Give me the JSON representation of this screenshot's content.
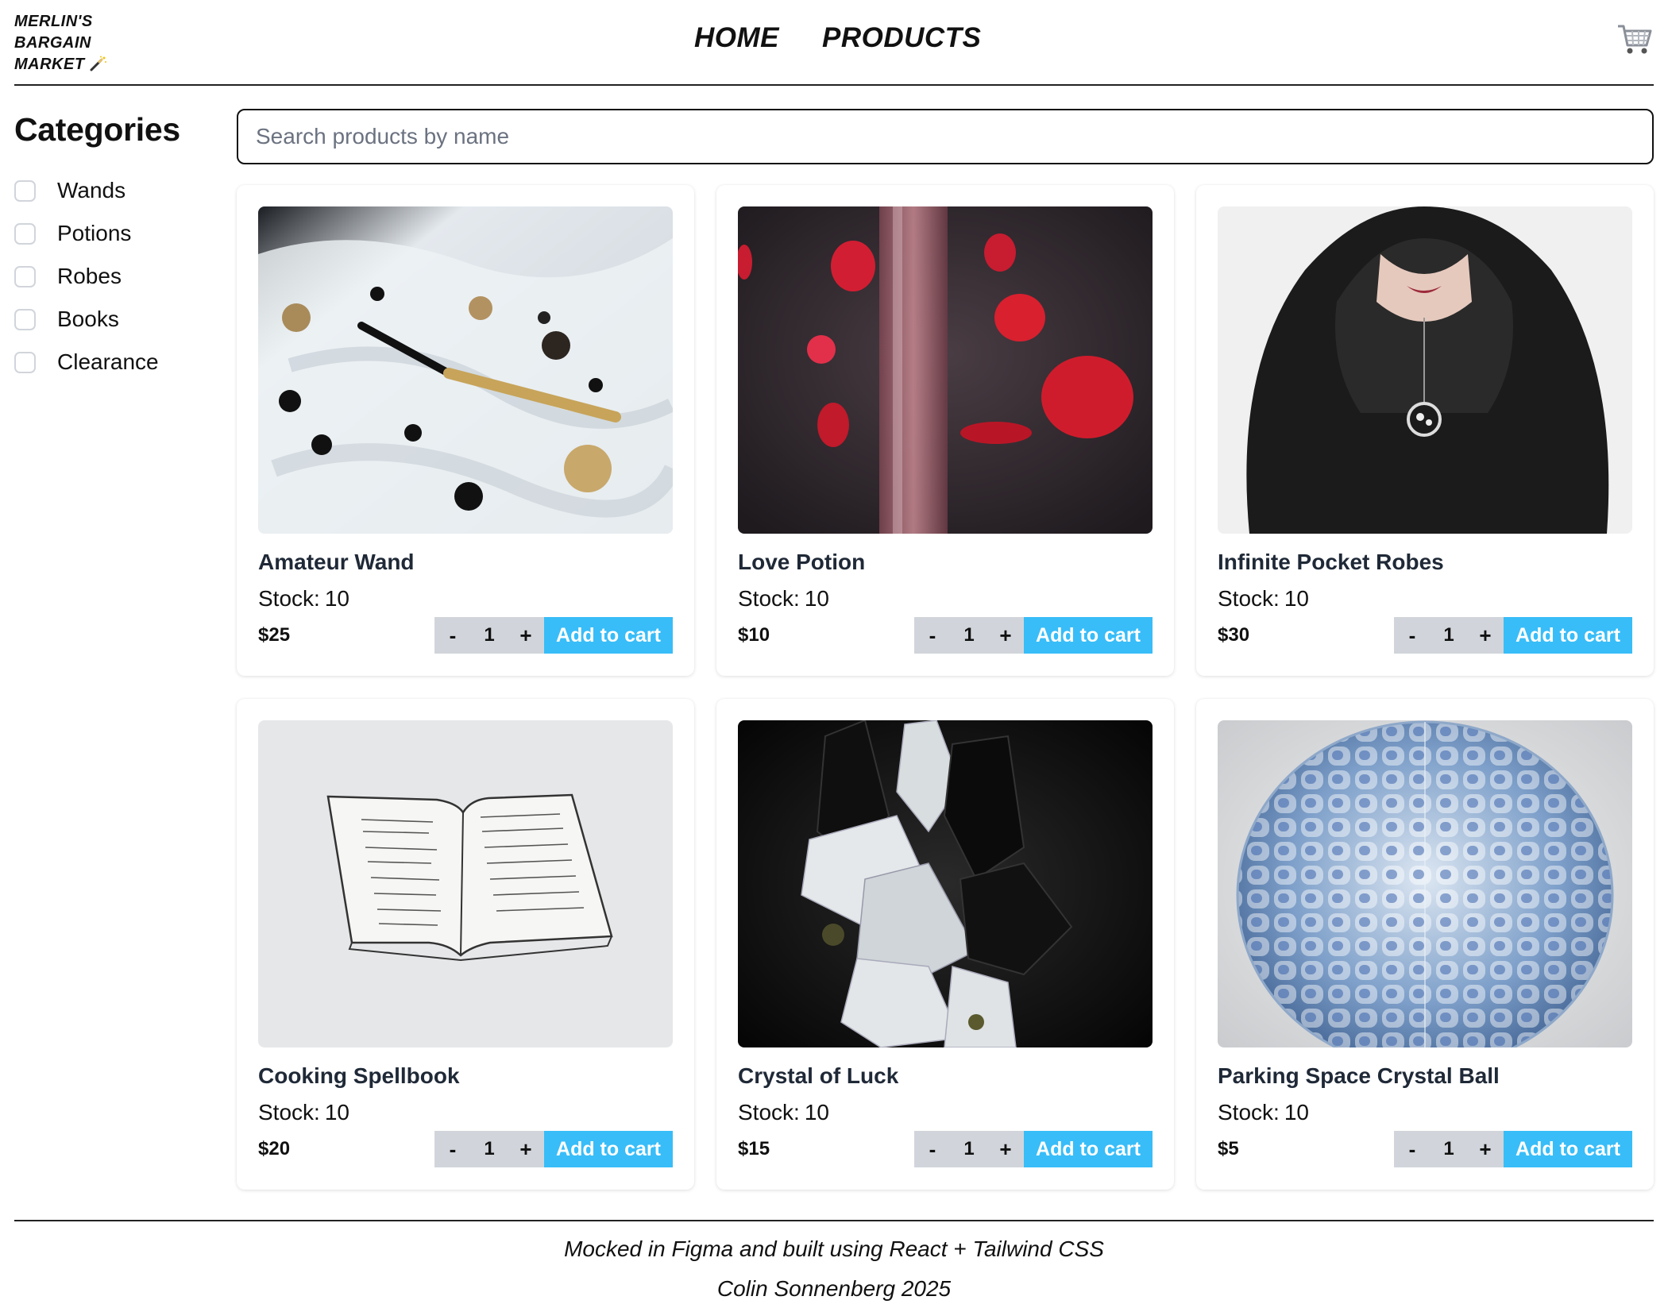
{
  "header": {
    "logo_line1": "MERLIN'S",
    "logo_line2": "BARGAIN",
    "logo_line3": "MARKET",
    "nav": [
      "HOME",
      "PRODUCTS"
    ]
  },
  "sidebar": {
    "title": "Categories",
    "categories": [
      "Wands",
      "Potions",
      "Robes",
      "Books",
      "Clearance"
    ]
  },
  "search": {
    "placeholder": "Search products by name",
    "value": ""
  },
  "products": [
    {
      "name": "Amateur Wand",
      "stock_label": "Stock:",
      "stock": "10",
      "price": "$25",
      "qty": "1",
      "add_label": "Add to cart"
    },
    {
      "name": "Love Potion",
      "stock_label": "Stock:",
      "stock": "10",
      "price": "$10",
      "qty": "1",
      "add_label": "Add to cart"
    },
    {
      "name": "Infinite Pocket Robes",
      "stock_label": "Stock:",
      "stock": "10",
      "price": "$30",
      "qty": "1",
      "add_label": "Add to cart"
    },
    {
      "name": "Cooking Spellbook",
      "stock_label": "Stock:",
      "stock": "10",
      "price": "$20",
      "qty": "1",
      "add_label": "Add to cart"
    },
    {
      "name": "Crystal of Luck",
      "stock_label": "Stock:",
      "stock": "10",
      "price": "$15",
      "qty": "1",
      "add_label": "Add to cart"
    },
    {
      "name": "Parking Space Crystal Ball",
      "stock_label": "Stock:",
      "stock": "10",
      "price": "$5",
      "qty": "1",
      "add_label": "Add to cart"
    }
  ],
  "qty_controls": {
    "minus": "-",
    "plus": "+"
  },
  "footer": {
    "line1": "Mocked in Figma and built using React + Tailwind CSS",
    "line2": "Colin Sonnenberg 2025"
  },
  "colors": {
    "accent": "#38bdf8",
    "qty_bg": "#d1d5db",
    "border": "#222222"
  },
  "icons": {
    "cart": "shopping-cart-icon",
    "logo": "magic-wand-icon"
  }
}
